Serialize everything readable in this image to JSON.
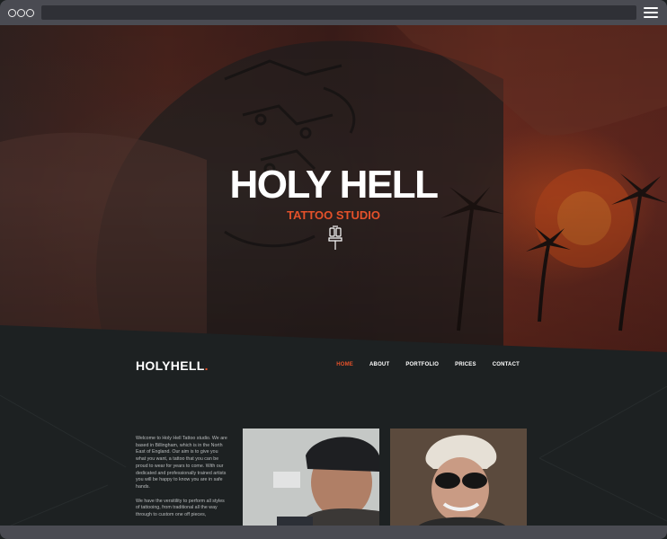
{
  "hero": {
    "title": "HOLY HELL",
    "subtitle": "TATTOO STUDIO"
  },
  "nav": {
    "logo_main": "HOLYHELL",
    "logo_dot": ".",
    "items": [
      {
        "label": "HOME",
        "active": true
      },
      {
        "label": "ABOUT",
        "active": false
      },
      {
        "label": "PORTFOLIO",
        "active": false
      },
      {
        "label": "PRICES",
        "active": false
      },
      {
        "label": "CONTACT",
        "active": false
      }
    ]
  },
  "intro": {
    "paragraph1": "Welcome to Holy Hell Tattoo studio. We are based in Billingham, which is in the North East of England. Our aim is to give you what you want, a tattoo that you can be proud to wear for years to come. With our dedicated and professionally trained artists you will be happy to know you are in safe hands.",
    "paragraph2": "We have the versitility to perform all styles of tattooing, from traditional all the way through to custom one off pieces,"
  },
  "colors": {
    "accent": "#e4512a",
    "background": "#1d2122",
    "chrome": "#4a4b52"
  },
  "icons": [
    "menu-icon",
    "tattoo-machine-icon"
  ]
}
